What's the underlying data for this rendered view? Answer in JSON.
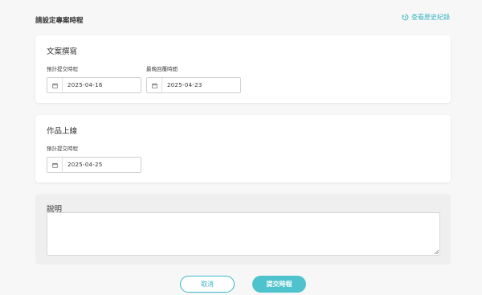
{
  "header": {
    "title": "請設定專案時程",
    "history_link": "查看歷史紀錄"
  },
  "sections": [
    {
      "title": "文案撰寫",
      "fields": [
        {
          "label": "預計提交時程",
          "value": "2025-04-16"
        },
        {
          "label": "最晚回覆時間",
          "value": "2025-04-23"
        }
      ]
    },
    {
      "title": "作品上線",
      "fields": [
        {
          "label": "預計提交時程",
          "value": "2025-04-25"
        }
      ]
    }
  ],
  "notes": {
    "title": "說明",
    "value": ""
  },
  "actions": {
    "cancel_label": "取消",
    "submit_label": "提交時程"
  },
  "colors": {
    "accent": "#3bb7c4",
    "submit_bg": "#4fc3cd",
    "background": "#f7f7f7"
  },
  "icons": {
    "history": "history-icon",
    "calendar": "calendar-icon"
  }
}
